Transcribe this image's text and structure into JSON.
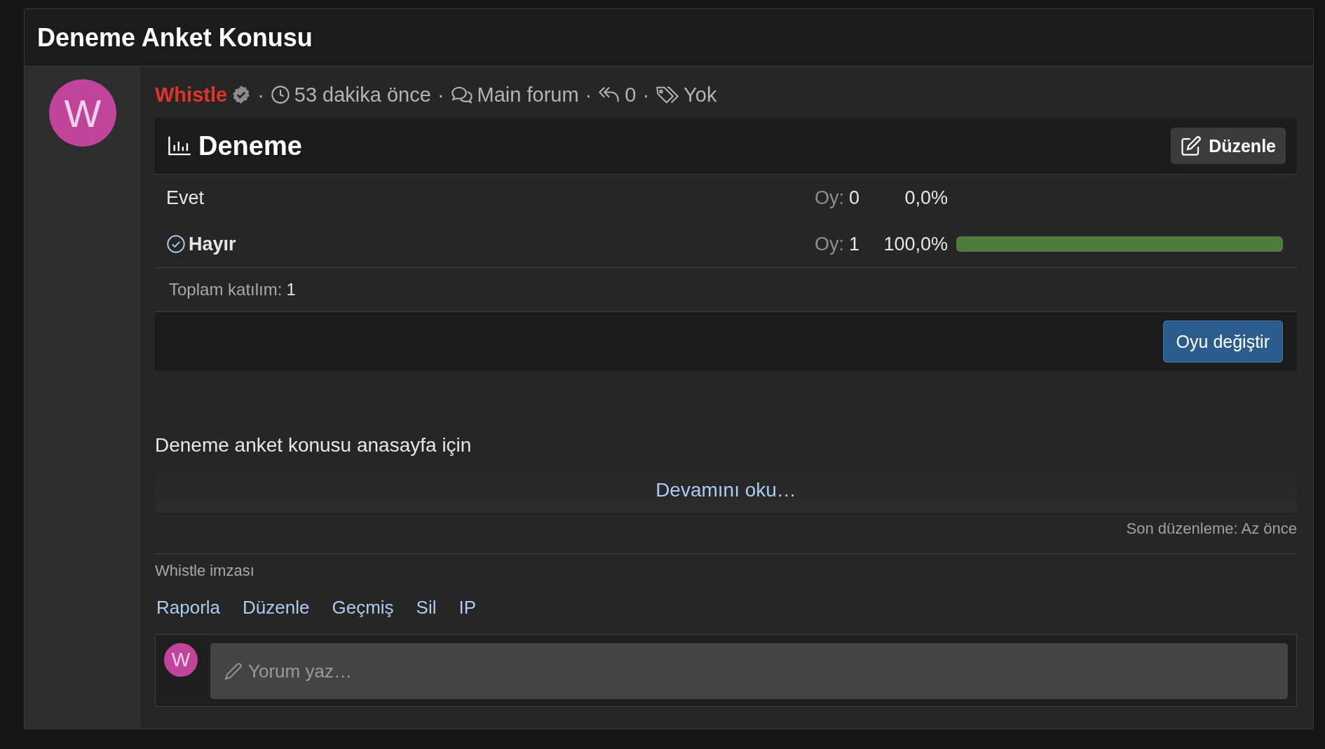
{
  "thread": {
    "title": "Deneme Anket Konusu"
  },
  "author": {
    "avatar_letter": "W"
  },
  "meta": [
    {
      "kind": "author",
      "text": "Whistle",
      "verified": true
    },
    {
      "kind": "separator",
      "text": "·"
    },
    {
      "kind": "time",
      "text": "53 dakika önce"
    },
    {
      "kind": "separator",
      "text": "·"
    },
    {
      "kind": "forum",
      "text": "Main forum"
    },
    {
      "kind": "separator",
      "text": "·"
    },
    {
      "kind": "replies",
      "text": "0"
    },
    {
      "kind": "separator",
      "text": "·"
    },
    {
      "kind": "tags",
      "text": "Yok"
    }
  ],
  "poll": {
    "title": "Deneme",
    "edit_button": "Düzenle",
    "options": [
      {
        "label": "Evet",
        "votes_label": "Oy:",
        "votes": "0",
        "percent": "0,0%",
        "selected": false
      },
      {
        "label": "Hayır",
        "votes_label": "Oy:",
        "votes": "1",
        "percent": "100,0%",
        "level": 1,
        "selected": true
      }
    ],
    "total_label": "Toplam katılım:",
    "total": "1",
    "vote_button": "Oyu değiştir"
  },
  "post": {
    "body": "Deneme anket konusu anasayfa için",
    "read_more": "Devamını oku…",
    "last_edit": "Son düzenleme: Az önce",
    "signature": "Whistle imzası",
    "actions": [
      "Raporla",
      "Düzenle",
      "Geçmiş",
      "Sil",
      "IP"
    ]
  },
  "comment": {
    "avatar_letter": "W",
    "placeholder": "Yorum yaz…"
  }
}
